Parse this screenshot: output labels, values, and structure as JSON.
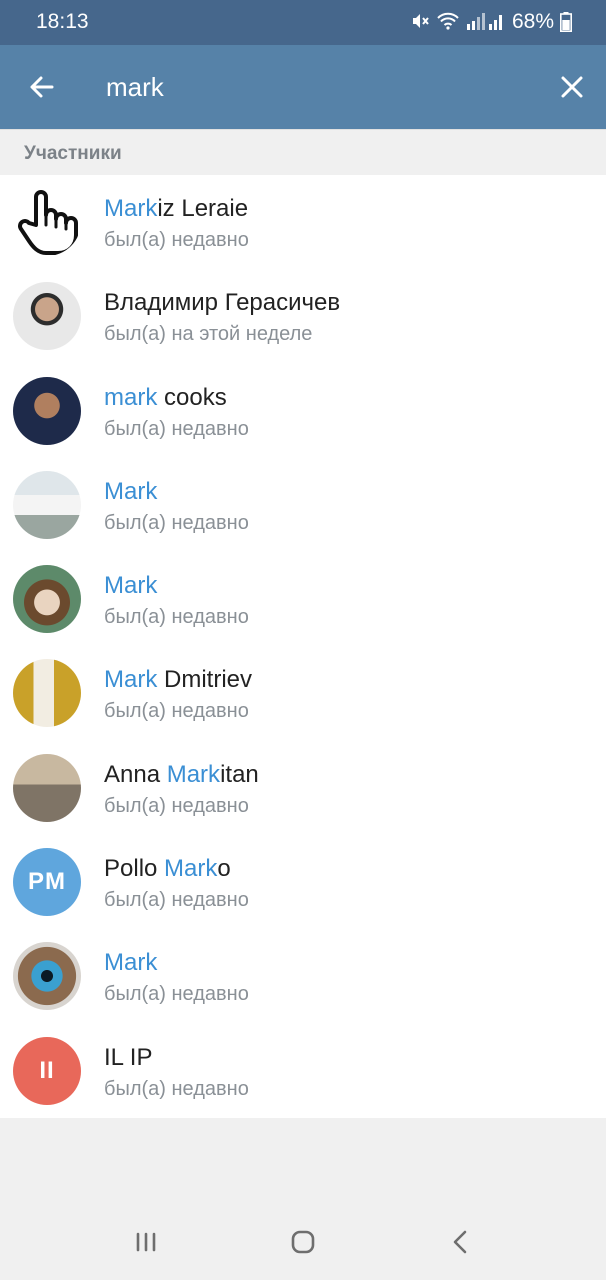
{
  "status_bar": {
    "time": "18:13",
    "battery": "68%",
    "icons": [
      "mute-icon",
      "wifi-icon",
      "signal-icon",
      "battery-icon"
    ]
  },
  "search": {
    "query": "mark",
    "back_icon": "arrow-left-icon",
    "clear_icon": "close-icon"
  },
  "section": {
    "title": "Участники"
  },
  "results": [
    {
      "name_match": "Mark",
      "name_rest": "iz Leraie",
      "name_prefix": "",
      "status": "был(а) недавно",
      "avatar": "pointing-hand-icon"
    },
    {
      "name_match": "",
      "name_rest": "Владимир Герасичев",
      "name_prefix": "",
      "status": "был(а) на этой неделе",
      "avatar": "photo"
    },
    {
      "name_match": "mark",
      "name_rest": " cooks",
      "name_prefix": "",
      "status": "был(а) недавно",
      "avatar": "photo"
    },
    {
      "name_match": "Mark",
      "name_rest": "",
      "name_prefix": "",
      "status": "был(а) недавно",
      "avatar": "photo"
    },
    {
      "name_match": "Mark",
      "name_rest": "",
      "name_prefix": "",
      "status": "был(а) недавно",
      "avatar": "photo"
    },
    {
      "name_match": "Mark",
      "name_rest": " Dmitriev",
      "name_prefix": "",
      "status": "был(а) недавно",
      "avatar": "photo"
    },
    {
      "name_prefix": "Anna ",
      "name_match": "Mark",
      "name_rest": "itan",
      "status": "был(а) недавно",
      "avatar": "photo"
    },
    {
      "name_prefix": "Pollo ",
      "name_match": "Mark",
      "name_rest": "o",
      "status": "был(а) недавно",
      "avatar": "initials",
      "initials": "PM",
      "avatar_color": "#5fa6dd"
    },
    {
      "name_match": "Mark",
      "name_rest": "",
      "name_prefix": "",
      "status": "был(а) недавно",
      "avatar": "photo"
    },
    {
      "name_prefix": "",
      "name_match": "",
      "name_rest": "IL IP",
      "status": "был(а) недавно",
      "avatar": "initials",
      "initials": "II",
      "avatar_color": "#e8685a"
    }
  ],
  "nav": {
    "icons": [
      "recent-apps-icon",
      "home-icon",
      "back-icon"
    ]
  },
  "colors": {
    "status_bar": "#46678c",
    "app_bar": "#5682a8",
    "highlight": "#3b8fd4"
  }
}
